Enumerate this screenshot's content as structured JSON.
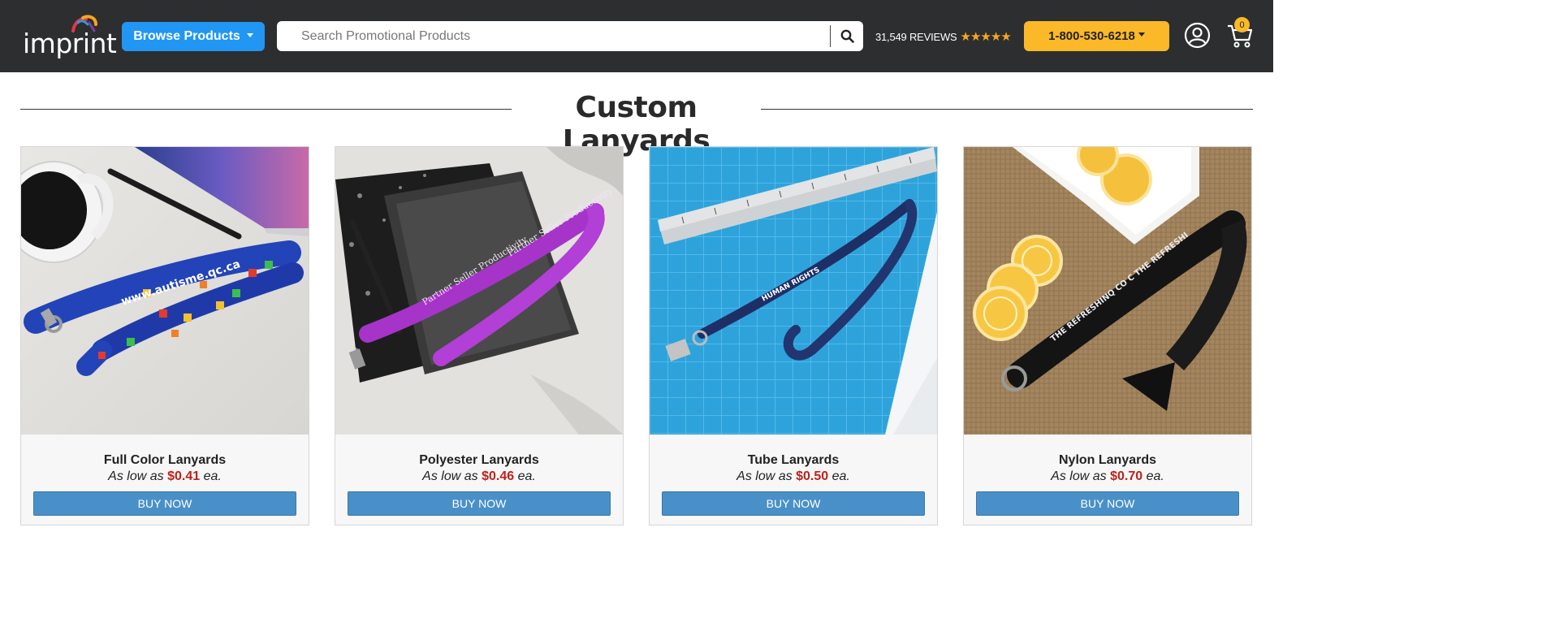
{
  "header": {
    "logo_text": "imprint",
    "browse_label": "Browse Products",
    "search_placeholder": "Search Promotional Products",
    "reviews_text": "31,549 REVIEWS",
    "stars": "★★★★★",
    "phone_label": "1-800-530-6218",
    "cart_count": "0"
  },
  "page_title": "Custom Lanyards",
  "products": [
    {
      "name": "Full Color Lanyards",
      "price_prefix": "As low as",
      "price": "$0.41",
      "price_suffix": "ea.",
      "button": "BUY NOW"
    },
    {
      "name": "Polyester Lanyards",
      "price_prefix": "As low as",
      "price": "$0.46",
      "price_suffix": "ea.",
      "button": "BUY NOW"
    },
    {
      "name": "Tube Lanyards",
      "price_prefix": "As low as",
      "price": "$0.50",
      "price_suffix": "ea.",
      "button": "BUY NOW"
    },
    {
      "name": "Nylon Lanyards",
      "price_prefix": "As low as",
      "price": "$0.70",
      "price_suffix": "ea.",
      "button": "BUY NOW"
    }
  ],
  "colors": {
    "header_bg": "#2d2e30",
    "browse_blue": "#2196f3",
    "phone_yellow": "#fbb829",
    "buy_blue": "#4a90c8",
    "price_red": "#c0201a"
  }
}
